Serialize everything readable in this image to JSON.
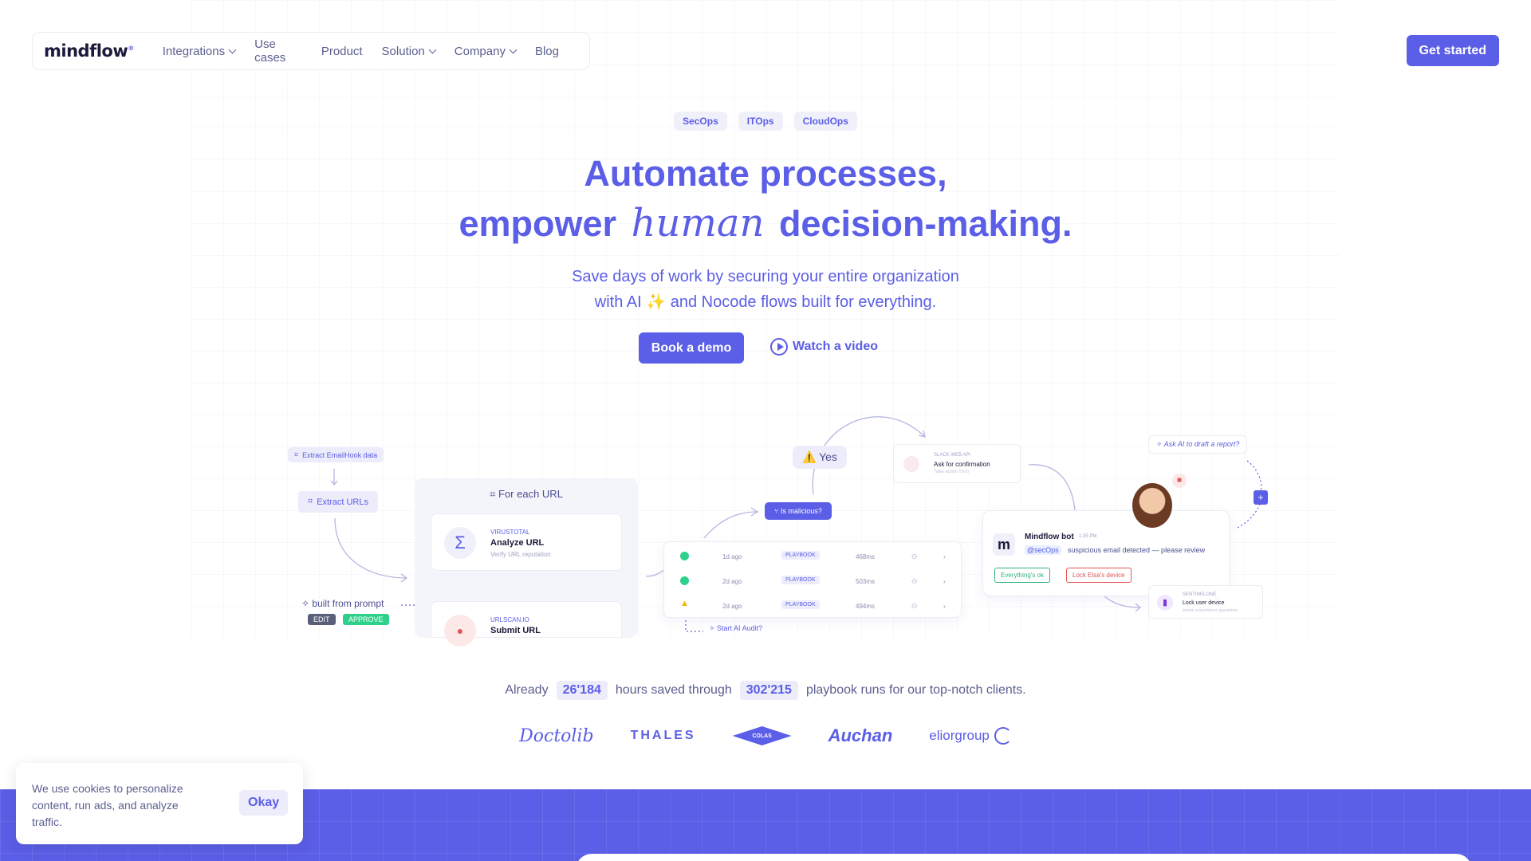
{
  "nav": {
    "logo": "mindflow",
    "logo_mark": "®",
    "items": [
      {
        "label": "Integrations",
        "dropdown": true
      },
      {
        "label": "Use cases",
        "dropdown": false
      },
      {
        "label": "Product",
        "dropdown": false
      },
      {
        "label": "Solution",
        "dropdown": true
      },
      {
        "label": "Company",
        "dropdown": true
      },
      {
        "label": "Blog",
        "dropdown": false
      }
    ],
    "cta": "Get started"
  },
  "hero": {
    "tags": [
      "SecOps",
      "ITOps",
      "CloudOps"
    ],
    "title_line1": "Automate processes,",
    "title_line2_pre": "empower",
    "title_line2_script": "human",
    "title_line2_post": "decision-making.",
    "subtitle_line1": "Save days of work by securing your entire organization",
    "subtitle_line2": "with AI ✨ and Nocode flows built for everything.",
    "btn_demo": "Book a demo",
    "btn_video": "Watch a video"
  },
  "diagram": {
    "extract_emailhook": "Extract EmailHook data",
    "extract_urls": "Extract URLs",
    "for_each_url": "For each URL",
    "virustotal_kicker": "VIRUSTOTAL",
    "virustotal_title": "Analyze URL",
    "virustotal_desc": "Verify URL reputation",
    "urlscan_kicker": "URLSCAN.IO",
    "urlscan_title": "Submit URL",
    "built_from_prompt": "built from prompt",
    "edit": "EDIT",
    "approve": "APPROVE",
    "yes": "⚠️ Yes",
    "is_malicious": "Is malicious?",
    "runs": [
      {
        "status": "ok",
        "time": "1d ago",
        "tag": "PLAYBOOK",
        "duration": "468ms"
      },
      {
        "status": "ok",
        "time": "2d ago",
        "tag": "PLAYBOOK",
        "duration": "503ms"
      },
      {
        "status": "warn",
        "time": "2d ago",
        "tag": "PLAYBOOK",
        "duration": "494ms"
      }
    ],
    "start_audit": "Start AI Audit?",
    "slack_kicker": "SLACK WEB API",
    "slack_title": "Ask for confirmation",
    "slack_desc": "Take action form",
    "bot_name": "Mindflow bot",
    "bot_time": "1:35 PM",
    "bot_mention": "@secOps",
    "bot_message": "suspicious email detected — please review",
    "btn_ok": "Everything's ok",
    "btn_lock": "Lock Elsa's device",
    "ask_ai": "Ask AI to draft a report?",
    "sentinel_kicker": "SENTINELONE",
    "sentinel_title": "Lock user device",
    "sentinel_desc": "isolate a machine in quarantine"
  },
  "stats": {
    "pre": "Already",
    "hours": "26'184",
    "mid": "hours saved through",
    "runs": "302'215",
    "post": "playbook runs for our top-notch clients."
  },
  "clients": {
    "doctolib": "Doctolib",
    "thales": "THALES",
    "colas": "COLAS",
    "auchan": "Auchan",
    "elior": "eliorgroup"
  },
  "cookie": {
    "text": "We use cookies to personalize content, run ads, and analyze traffic.",
    "button": "Okay"
  },
  "colors": {
    "accent": "#5b5ee6",
    "success": "#2fd18a",
    "danger": "#e05555"
  }
}
